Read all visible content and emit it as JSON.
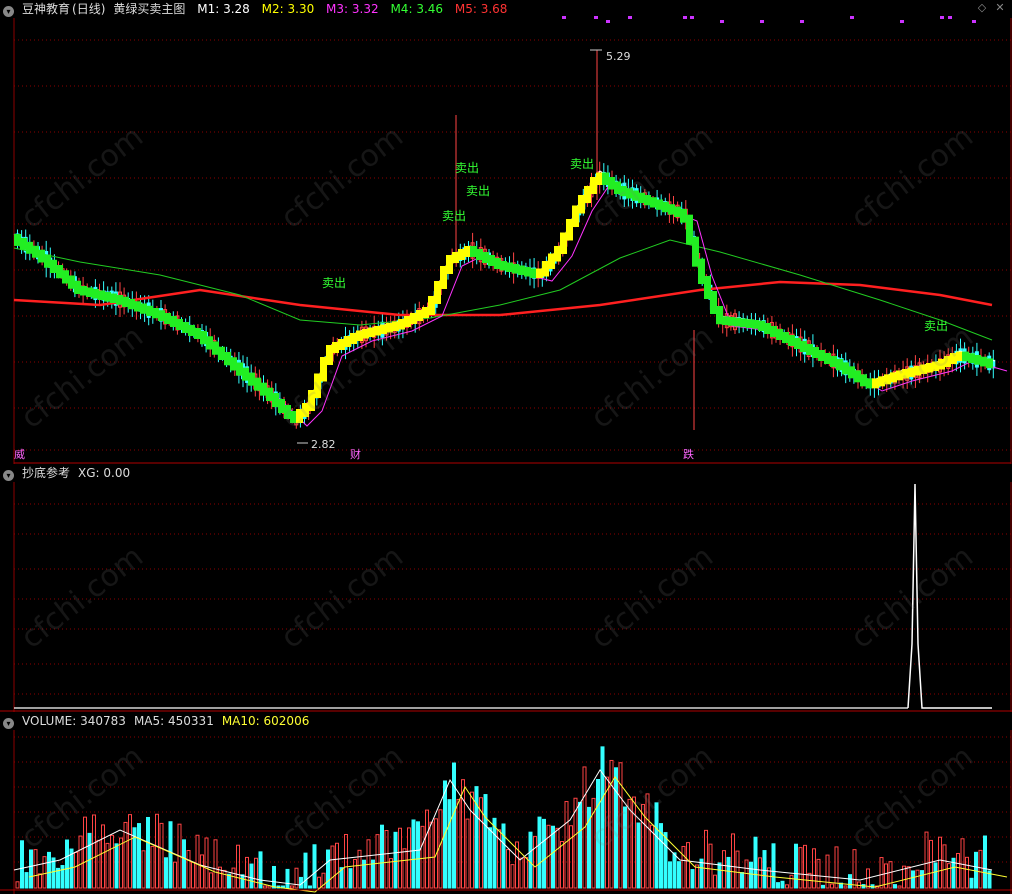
{
  "main": {
    "app_name": "豆神教育",
    "period": "(日线)",
    "indicator": "黄绿买卖主图",
    "ma": [
      {
        "label": "M1:",
        "value": "3.28",
        "color": "#ffffff"
      },
      {
        "label": "M2:",
        "value": "3.30",
        "color": "#ffff00"
      },
      {
        "label": "M3:",
        "value": "3.32",
        "color": "#ff33ff"
      },
      {
        "label": "M4:",
        "value": "3.46",
        "color": "#33ff33"
      },
      {
        "label": "M5:",
        "value": "3.68",
        "color": "#ff3333"
      }
    ],
    "high_label": "5.29",
    "low_label": "2.82",
    "sell_label": "卖出",
    "markers": [
      "威",
      "财",
      "跌"
    ]
  },
  "sub": {
    "title": "抄底参考",
    "xg_label": "XG:",
    "xg_value": "0.00"
  },
  "volume": {
    "vol_label": "VOLUME:",
    "vol_value": "340783",
    "ma5_label": "MA5:",
    "ma5_value": "450331",
    "ma10_label": "MA10:",
    "ma10_value": "602006"
  },
  "colors": {
    "up": "#ff4444",
    "down": "#33ffff",
    "grid": "#8b0000"
  },
  "watermark": "cfchi.com"
}
